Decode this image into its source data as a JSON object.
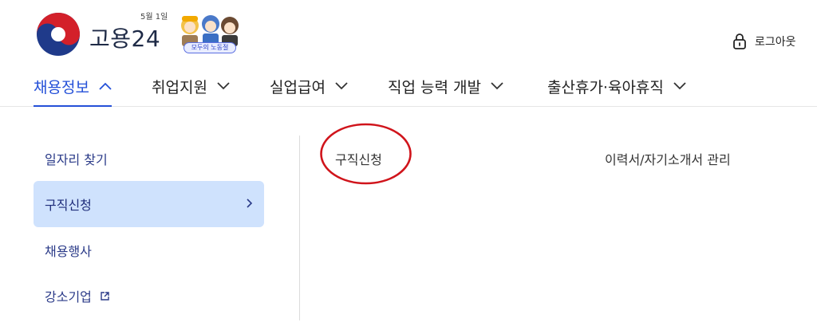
{
  "header": {
    "logo_text": "고용24",
    "logo_date": "5월 1일",
    "event_badge": "모두의 노동절",
    "logout_label": "로그아웃"
  },
  "gnb": {
    "items": [
      {
        "label": "채용정보",
        "active": true
      },
      {
        "label": "취업지원",
        "active": false
      },
      {
        "label": "실업급여",
        "active": false
      },
      {
        "label": "직업 능력 개발",
        "active": false
      },
      {
        "label": "출산휴가·육아휴직",
        "active": false
      }
    ]
  },
  "lnb": {
    "items": [
      {
        "label": "일자리 찾기",
        "selected": false
      },
      {
        "label": "구직신청",
        "selected": true
      },
      {
        "label": "채용행사",
        "selected": false
      },
      {
        "label": "강소기업",
        "selected": false,
        "external": true
      }
    ]
  },
  "submenu": {
    "items": [
      {
        "label": "구직신청",
        "circled": true
      },
      {
        "label": "이력서/자기소개서 관리",
        "circled": false
      }
    ]
  },
  "colors": {
    "accent": "#2450d8",
    "selected_bg": "#cfe2fd",
    "annotation_red": "#d0141b"
  }
}
